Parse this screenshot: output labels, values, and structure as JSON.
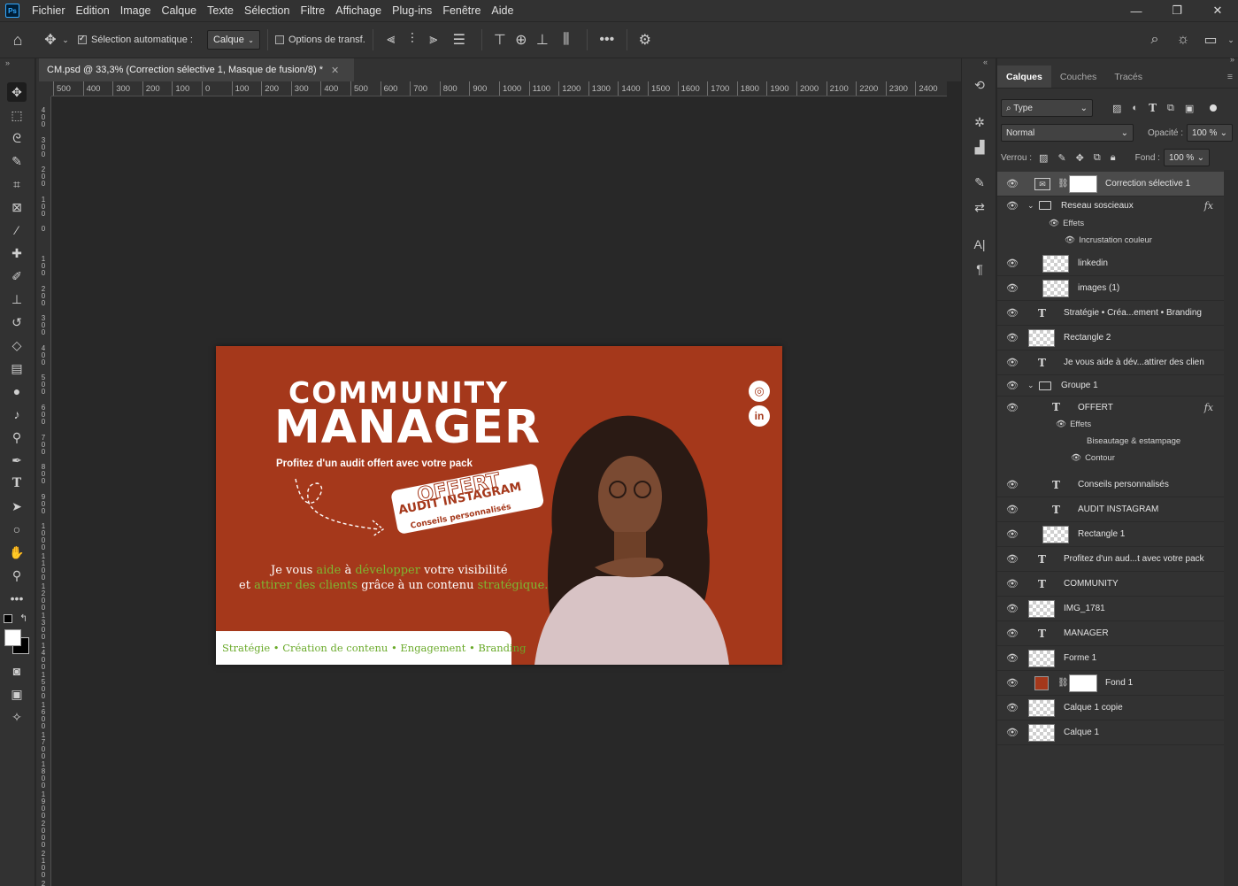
{
  "menu": {
    "logo": "Ps",
    "items": [
      "Fichier",
      "Edition",
      "Image",
      "Calque",
      "Texte",
      "Sélection",
      "Filtre",
      "Affichage",
      "Plug-ins",
      "Fenêtre",
      "Aide"
    ]
  },
  "options_bar": {
    "auto_select_label": "Sélection automatique :",
    "auto_select_target": "Calque",
    "transform_options_label": "Options de transf."
  },
  "document": {
    "tab_title": "CM.psd @ 33,3% (Correction sélective 1, Masque de fusion/8) *",
    "ruler_labels": [
      "500",
      "400",
      "300",
      "200",
      "100",
      "0",
      "100",
      "200",
      "300",
      "400",
      "500",
      "600",
      "700",
      "800",
      "900",
      "1000",
      "1100",
      "1200",
      "1300",
      "1400",
      "1500",
      "1600",
      "1700",
      "1800",
      "1900",
      "2000",
      "2100",
      "2200",
      "2300",
      "2400"
    ]
  },
  "artwork": {
    "title_top": "COMMUNITY",
    "title_bottom": "MANAGER",
    "subtitle": "Profitez d'un audit offert avec votre pack",
    "badge_offert": "OFFERT",
    "badge_audit": "AUDIT INSTAGRAM",
    "badge_conseils": "Conseils personnalisés",
    "line1_a": "Je vous ",
    "line1_b": "aide",
    "line1_c": " à ",
    "line1_d": "développer",
    "line1_e": " votre visibilité",
    "line2_a": "et ",
    "line2_b": "attirer des clients",
    "line2_c": " grâce à un contenu ",
    "line2_d": "stratégique.",
    "bottom_tagline": "Stratégie • Création de contenu • Engagement • Branding",
    "colors": {
      "background": "#a5381b",
      "accent_green": "#7db833"
    }
  },
  "panel": {
    "tabs": [
      "Calques",
      "Couches",
      "Tracés"
    ],
    "filter_label": "Type",
    "blend_mode": "Normal",
    "opacity_label": "Opacité :",
    "opacity_value": "100 %",
    "lock_label": "Verrou :",
    "fill_label": "Fond :",
    "fill_value": "100 %",
    "layers": [
      {
        "name": "Correction sélective 1",
        "selected": true
      },
      {
        "name": "Reseau soscieaux"
      },
      {
        "name": "Effets"
      },
      {
        "name": "Incrustation couleur"
      },
      {
        "name": "linkedin"
      },
      {
        "name": "images (1)"
      },
      {
        "name": "Stratégie • Créa...ement • Branding"
      },
      {
        "name": "Rectangle 2"
      },
      {
        "name": "Je vous aide à dév...attirer des clien"
      },
      {
        "name": "Groupe 1"
      },
      {
        "name": "OFFERT"
      },
      {
        "name": "Effets"
      },
      {
        "name": "Biseautage & estampage"
      },
      {
        "name": "Contour"
      },
      {
        "name": "Conseils personnalisés"
      },
      {
        "name": "AUDIT INSTAGRAM"
      },
      {
        "name": "Rectangle 1"
      },
      {
        "name": "Profitez d'un aud...t avec votre pack"
      },
      {
        "name": "COMMUNITY"
      },
      {
        "name": "IMG_1781"
      },
      {
        "name": "MANAGER"
      },
      {
        "name": "Forme 1"
      },
      {
        "name": "Fond 1"
      },
      {
        "name": "Calque 1 copie"
      },
      {
        "name": "Calque 1"
      }
    ],
    "fx_label": "fx"
  }
}
